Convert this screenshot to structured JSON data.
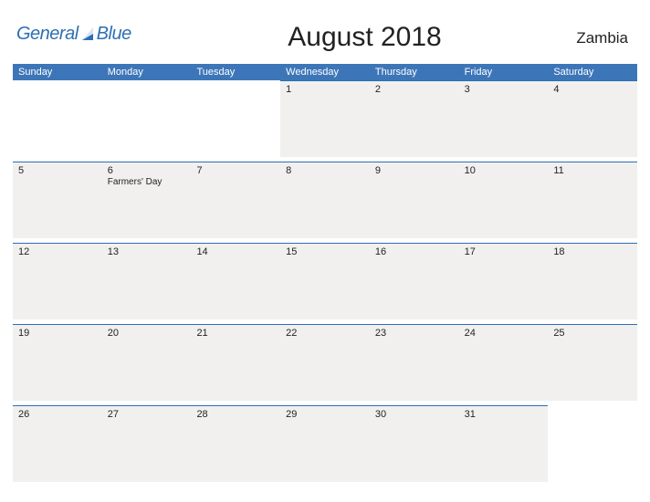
{
  "header": {
    "logo_general": "General",
    "logo_blue": "Blue",
    "title": "August 2018",
    "country": "Zambia"
  },
  "day_headers": [
    "Sunday",
    "Monday",
    "Tuesday",
    "Wednesday",
    "Thursday",
    "Friday",
    "Saturday"
  ],
  "weeks": [
    [
      {
        "day": "",
        "event": ""
      },
      {
        "day": "",
        "event": ""
      },
      {
        "day": "",
        "event": ""
      },
      {
        "day": "1",
        "event": ""
      },
      {
        "day": "2",
        "event": ""
      },
      {
        "day": "3",
        "event": ""
      },
      {
        "day": "4",
        "event": ""
      }
    ],
    [
      {
        "day": "5",
        "event": ""
      },
      {
        "day": "6",
        "event": "Farmers' Day"
      },
      {
        "day": "7",
        "event": ""
      },
      {
        "day": "8",
        "event": ""
      },
      {
        "day": "9",
        "event": ""
      },
      {
        "day": "10",
        "event": ""
      },
      {
        "day": "11",
        "event": ""
      }
    ],
    [
      {
        "day": "12",
        "event": ""
      },
      {
        "day": "13",
        "event": ""
      },
      {
        "day": "14",
        "event": ""
      },
      {
        "day": "15",
        "event": ""
      },
      {
        "day": "16",
        "event": ""
      },
      {
        "day": "17",
        "event": ""
      },
      {
        "day": "18",
        "event": ""
      }
    ],
    [
      {
        "day": "19",
        "event": ""
      },
      {
        "day": "20",
        "event": ""
      },
      {
        "day": "21",
        "event": ""
      },
      {
        "day": "22",
        "event": ""
      },
      {
        "day": "23",
        "event": ""
      },
      {
        "day": "24",
        "event": ""
      },
      {
        "day": "25",
        "event": ""
      }
    ],
    [
      {
        "day": "26",
        "event": ""
      },
      {
        "day": "27",
        "event": ""
      },
      {
        "day": "28",
        "event": ""
      },
      {
        "day": "29",
        "event": ""
      },
      {
        "day": "30",
        "event": ""
      },
      {
        "day": "31",
        "event": ""
      },
      {
        "day": "",
        "event": ""
      }
    ]
  ]
}
